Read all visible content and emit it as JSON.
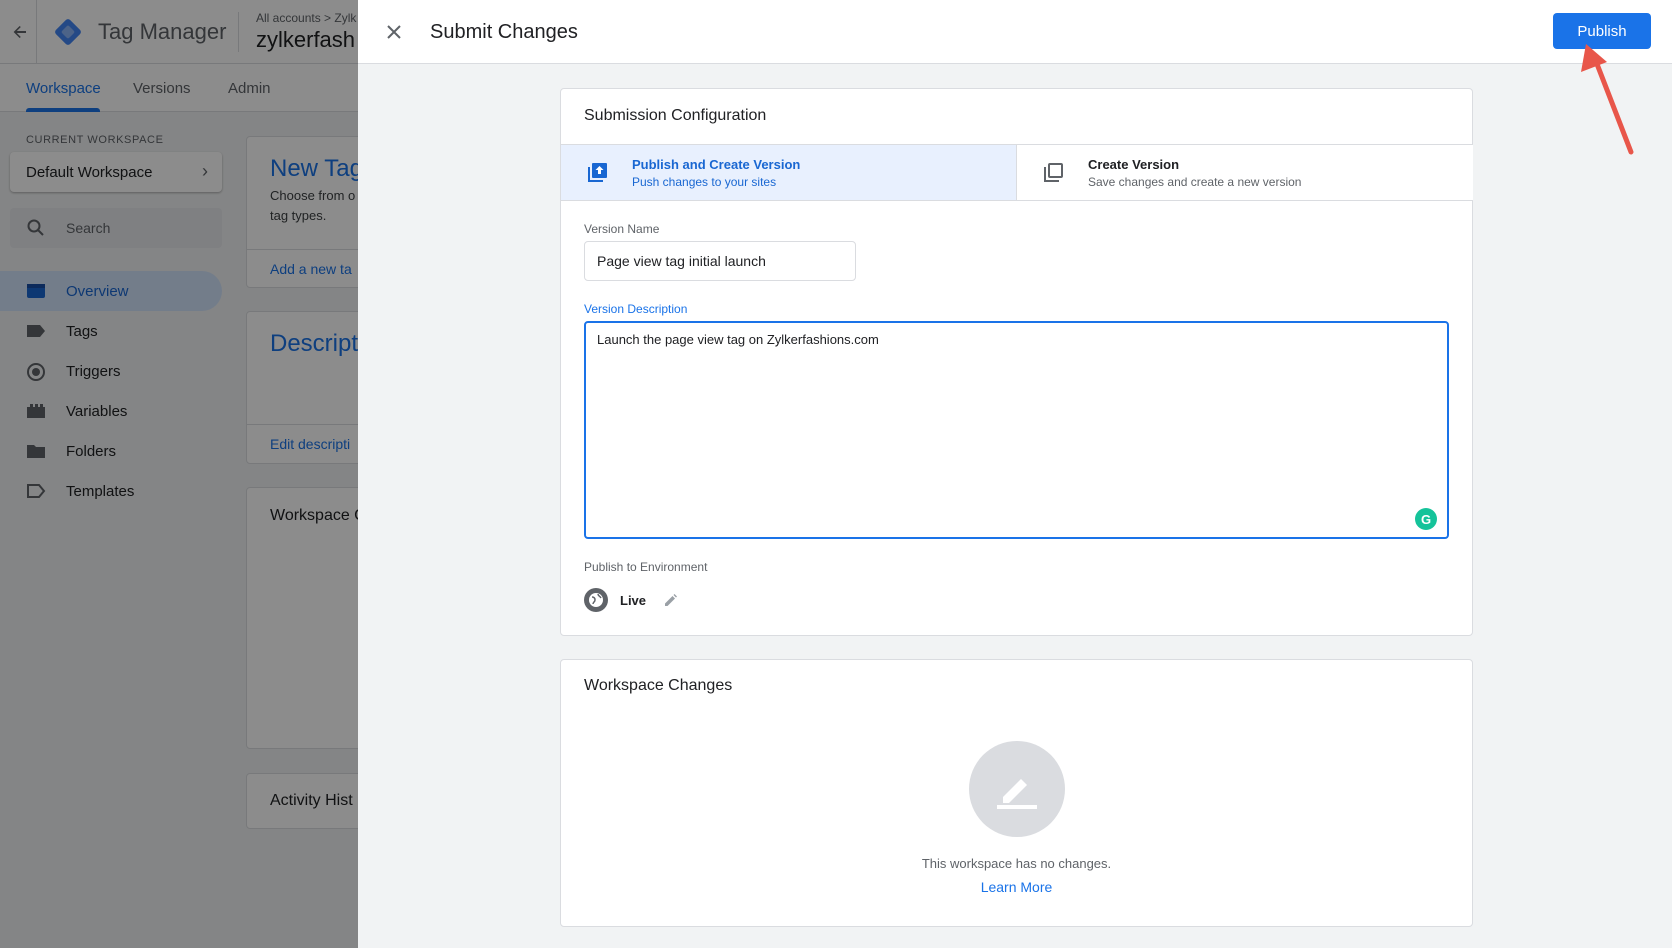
{
  "background": {
    "app_name": "Tag Manager",
    "breadcrumb": "All accounts > Zylk",
    "container_name": "zylkerfash",
    "tabs": [
      {
        "label": "Workspace"
      },
      {
        "label": "Versions"
      },
      {
        "label": "Admin"
      }
    ],
    "current_workspace_label": "CURRENT WORKSPACE",
    "workspace_name": "Default Workspace",
    "search_placeholder": "Search",
    "nav": [
      {
        "label": "Overview",
        "icon": "overview-icon"
      },
      {
        "label": "Tags",
        "icon": "tag-icon"
      },
      {
        "label": "Triggers",
        "icon": "trigger-icon"
      },
      {
        "label": "Variables",
        "icon": "variables-icon"
      },
      {
        "label": "Folders",
        "icon": "folder-icon"
      },
      {
        "label": "Templates",
        "icon": "template-icon"
      }
    ],
    "cards": {
      "new_tag": {
        "title": "New Tag",
        "text_line1": "Choose from o",
        "text_line2": "tag types.",
        "link": "Add a new ta"
      },
      "description": {
        "title": "Descript",
        "link": "Edit descripti"
      },
      "workspace_changes_title": "Workspace C",
      "activity_history_title": "Activity Hist"
    }
  },
  "sheet": {
    "title": "Submit Changes",
    "publish_label": "Publish",
    "submission": {
      "title": "Submission Configuration",
      "options": [
        {
          "title": "Publish and Create Version",
          "subtitle": "Push changes to your sites",
          "selected": true,
          "icon": "publish-version-icon"
        },
        {
          "title": "Create Version",
          "subtitle": "Save changes and create a new version",
          "selected": false,
          "icon": "create-version-icon"
        }
      ],
      "version_name_label": "Version Name",
      "version_name_value": "Page view tag initial launch",
      "version_description_label": "Version Description",
      "version_description_value": "Launch the page view tag on Zylkerfashions.com",
      "environment_label": "Publish to Environment",
      "environment_name": "Live"
    },
    "workspace_changes": {
      "title": "Workspace Changes",
      "empty_text": "This workspace has no changes.",
      "learn_more": "Learn More"
    }
  },
  "colors": {
    "accent": "#1a73e8",
    "selected_bg": "#e8f0fe",
    "annotation_arrow": "#e8564a"
  }
}
